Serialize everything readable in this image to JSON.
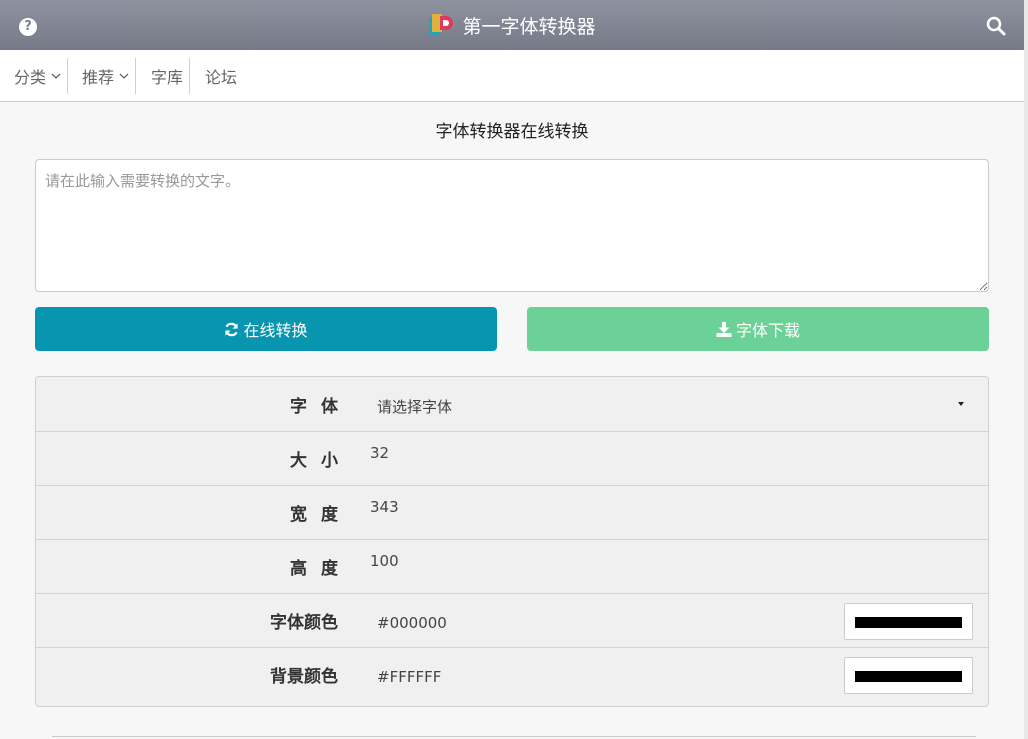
{
  "header": {
    "title": "第一字体转换器",
    "help_icon": "?",
    "search_icon": "search-icon",
    "logo_icon": "site-logo"
  },
  "nav": {
    "items": [
      {
        "label": "分类",
        "dropdown": true
      },
      {
        "label": "推荐",
        "dropdown": true
      },
      {
        "label": "字库",
        "dropdown": false
      },
      {
        "label": "论坛",
        "dropdown": false
      }
    ]
  },
  "main": {
    "heading": "字体转换器在线转换",
    "input_placeholder": "请在此输入需要转换的文字。",
    "input_value": "",
    "convert_label": "在线转换",
    "download_label": "字体下载"
  },
  "settings": {
    "font": {
      "label": "字体",
      "value": "请选择字体"
    },
    "size": {
      "label": "大小",
      "value": "32"
    },
    "width": {
      "label": "宽度",
      "value": "343"
    },
    "height": {
      "label": "高度",
      "value": "100"
    },
    "font_color": {
      "label": "字体颜色",
      "value": "#000000"
    },
    "bg_color": {
      "label": "背景颜色",
      "value": "#FFFFFF"
    }
  },
  "colors": {
    "header_bg": "#7e828f",
    "convert_button": "#0795b0",
    "download_button": "#6bd197",
    "swatch": "#000000"
  }
}
